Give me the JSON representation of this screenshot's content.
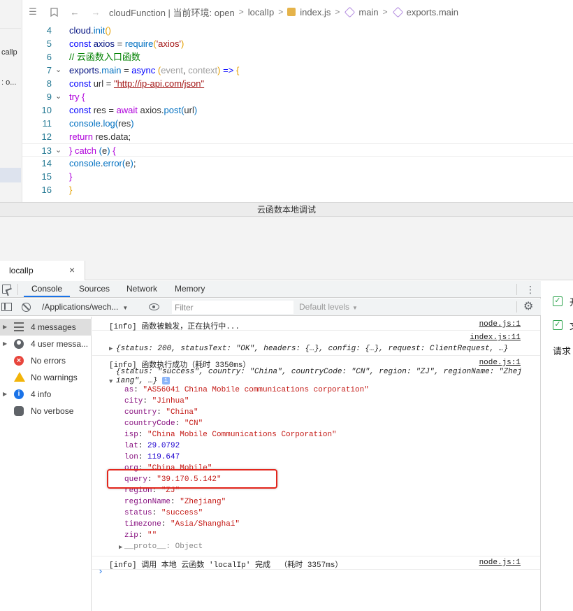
{
  "editor": {
    "left_items": [
      "callp",
      ": o..."
    ],
    "breadcrumb": {
      "path": "cloudFunction | 当前环境: open",
      "folder": "localIp",
      "file": "index.js",
      "symbol1": "main",
      "symbol2": "exports.main"
    },
    "lines": [
      {
        "num": "4",
        "fold": "",
        "segs": [
          [
            "var",
            "cloud"
          ],
          [
            "pl",
            "."
          ],
          [
            "fnb",
            "init"
          ],
          [
            "par",
            "()"
          ]
        ]
      },
      {
        "num": "5",
        "fold": "",
        "segs": [
          [
            "kw",
            "const "
          ],
          [
            "var",
            "axios"
          ],
          [
            "pl",
            " = "
          ],
          [
            "fnb",
            "require"
          ],
          [
            "par",
            "("
          ],
          [
            "str",
            "'axios'"
          ],
          [
            "par",
            ")"
          ]
        ]
      },
      {
        "num": "6",
        "fold": "",
        "segs": [
          [
            "cm",
            "// 云函数入口函数"
          ]
        ]
      },
      {
        "num": "7",
        "fold": "⌄",
        "segs": [
          [
            "var",
            "exports"
          ],
          [
            "pl",
            "."
          ],
          [
            "fnb",
            "main"
          ],
          [
            "pl",
            " = "
          ],
          [
            "kw",
            "async "
          ],
          [
            "par",
            "("
          ],
          [
            "pr",
            "event"
          ],
          [
            "pl",
            ", "
          ],
          [
            "pr",
            "context"
          ],
          [
            "par",
            ")"
          ],
          [
            "kw",
            " => "
          ],
          [
            "par",
            "{"
          ]
        ]
      },
      {
        "num": "8",
        "fold": "",
        "segs": [
          [
            "kw",
            "  const "
          ],
          [
            "pl",
            "url = "
          ],
          [
            "url",
            "\"http://ip-api.com/json\""
          ]
        ]
      },
      {
        "num": "9",
        "fold": "⌄",
        "segs": [
          [
            "kw2",
            "  try "
          ],
          [
            "br2",
            "{"
          ]
        ]
      },
      {
        "num": "10",
        "fold": "",
        "segs": [
          [
            "kw",
            "  const "
          ],
          [
            "pl",
            "res = "
          ],
          [
            "kw2",
            "await "
          ],
          [
            "pl",
            "axios."
          ],
          [
            "fnb",
            "post"
          ],
          [
            "br3",
            "("
          ],
          [
            "pl",
            "url"
          ],
          [
            "br3",
            ")"
          ]
        ]
      },
      {
        "num": "11",
        "fold": "",
        "segs": [
          [
            "pl",
            "  "
          ],
          [
            "fnb",
            "console"
          ],
          [
            "pl",
            "."
          ],
          [
            "fnb",
            "log"
          ],
          [
            "br3",
            "("
          ],
          [
            "pl",
            "res"
          ],
          [
            "br3",
            ")"
          ]
        ]
      },
      {
        "num": "12",
        "fold": "",
        "segs": [
          [
            "kw2",
            "  return "
          ],
          [
            "pl",
            "res.data;"
          ]
        ]
      },
      {
        "num": "13",
        "fold": "⌄",
        "segs": [
          [
            "br2",
            "  } "
          ],
          [
            "kw2",
            "catch "
          ],
          [
            "br3",
            "("
          ],
          [
            "pl",
            "e"
          ],
          [
            "br3",
            ") "
          ],
          [
            "br2",
            "{"
          ]
        ]
      },
      {
        "num": "14",
        "fold": "",
        "segs": [
          [
            "pl",
            "  "
          ],
          [
            "fnb",
            "console"
          ],
          [
            "pl",
            "."
          ],
          [
            "fnb",
            "error"
          ],
          [
            "br3",
            "("
          ],
          [
            "pl",
            "e"
          ],
          [
            "br3",
            ")"
          ],
          [
            "pl",
            ";"
          ]
        ]
      },
      {
        "num": "15",
        "fold": "",
        "segs": [
          [
            "br2",
            "  }"
          ]
        ]
      },
      {
        "num": "16",
        "fold": "",
        "segs": [
          [
            "par",
            "}"
          ]
        ]
      }
    ]
  },
  "panel_title": "云函数本地调试",
  "tab": {
    "label": "localIp",
    "close": "×"
  },
  "devtools": {
    "tabs": [
      "Console",
      "Sources",
      "Network",
      "Memory"
    ],
    "context": "/Applications/wech...",
    "filter_placeholder": "Filter",
    "levels": "Default levels",
    "sidebar": [
      {
        "label": "4 messages",
        "icon": "list-icon"
      },
      {
        "label": "4 user messa...",
        "icon": "user-icon"
      },
      {
        "label": "No errors",
        "icon": "error-icon"
      },
      {
        "label": "No warnings",
        "icon": "warning-icon"
      },
      {
        "label": "4 info",
        "icon": "info-icon"
      },
      {
        "label": "No verbose",
        "icon": "bug-icon"
      }
    ]
  },
  "console": {
    "msg1": "[info] 函数被触发，正在执行中...",
    "msg1_src": "node.js:1",
    "msg2_src": "index.js:11",
    "msg2": "{status: 200, statusText: \"OK\", headers: {…}, config: {…}, request: ClientRequest, …}",
    "msg3": "[info] 函数执行成功（耗时 3350ms）",
    "msg3_src": "node.js:1",
    "msg3_obj_line1": "{status: \"success\", country: \"China\", countryCode: \"CN\", region: \"ZJ\", regionName: \"Zhej",
    "msg3_obj_line2": "iang\", …}",
    "info_badge": "i",
    "props": [
      {
        "key": "as",
        "val": "\"AS56041 China Mobile communications corporation\"",
        "type": "s"
      },
      {
        "key": "city",
        "val": "\"Jinhua\"",
        "type": "s"
      },
      {
        "key": "country",
        "val": "\"China\"",
        "type": "s"
      },
      {
        "key": "countryCode",
        "val": "\"CN\"",
        "type": "s"
      },
      {
        "key": "isp",
        "val": "\"China Mobile Communications Corporation\"",
        "type": "s"
      },
      {
        "key": "lat",
        "val": "29.0792",
        "type": "n"
      },
      {
        "key": "lon",
        "val": "119.647",
        "type": "n"
      },
      {
        "key": "org",
        "val": "\"China Mobile\"",
        "type": "s"
      },
      {
        "key": "query",
        "val": "\"39.170.5.142\"",
        "type": "s"
      },
      {
        "key": "region",
        "val": "\"ZJ\"",
        "type": "s"
      },
      {
        "key": "regionName",
        "val": "\"Zhejiang\"",
        "type": "s"
      },
      {
        "key": "status",
        "val": "\"success\"",
        "type": "s"
      },
      {
        "key": "timezone",
        "val": "\"Asia/Shanghai\"",
        "type": "s"
      },
      {
        "key": "zip",
        "val": "\"\"",
        "type": "s"
      }
    ],
    "proto": "__proto__: Object",
    "msg4": "[info] 调用 本地 云函数 'localIp' 完成  （耗时 3357ms）",
    "msg4_src": "node.js:1",
    "prompt": "›"
  },
  "right_panel": {
    "items": [
      "开",
      "文"
    ],
    "text": "请求"
  }
}
